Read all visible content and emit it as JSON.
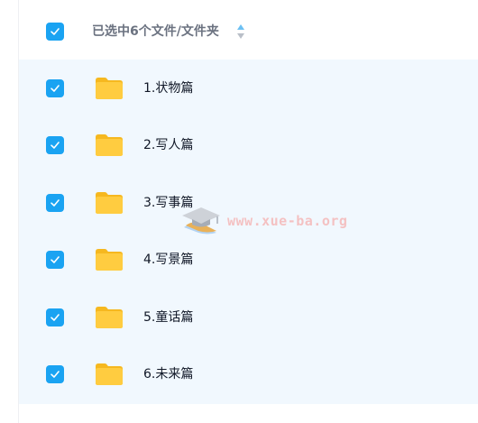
{
  "header": {
    "title": "已选中6个文件/文件夹",
    "select_all_checked": true,
    "sort_icon": "sort-up-down-icon"
  },
  "files": [
    {
      "name": "1.状物篇",
      "type": "folder",
      "checked": true
    },
    {
      "name": "2.写人篇",
      "type": "folder",
      "checked": true
    },
    {
      "name": "3.写事篇",
      "type": "folder",
      "checked": true
    },
    {
      "name": "4.写景篇",
      "type": "folder",
      "checked": true
    },
    {
      "name": "5.童话篇",
      "type": "folder",
      "checked": true
    },
    {
      "name": "6.未来篇",
      "type": "folder",
      "checked": true
    }
  ],
  "watermark": {
    "text": "www.xue-ba.org",
    "icon": "graduation-cap-icon"
  },
  "colors": {
    "accent": "#1aa3f2",
    "selected_bg": "#f1f8fe",
    "folder": "#ffc93c"
  }
}
